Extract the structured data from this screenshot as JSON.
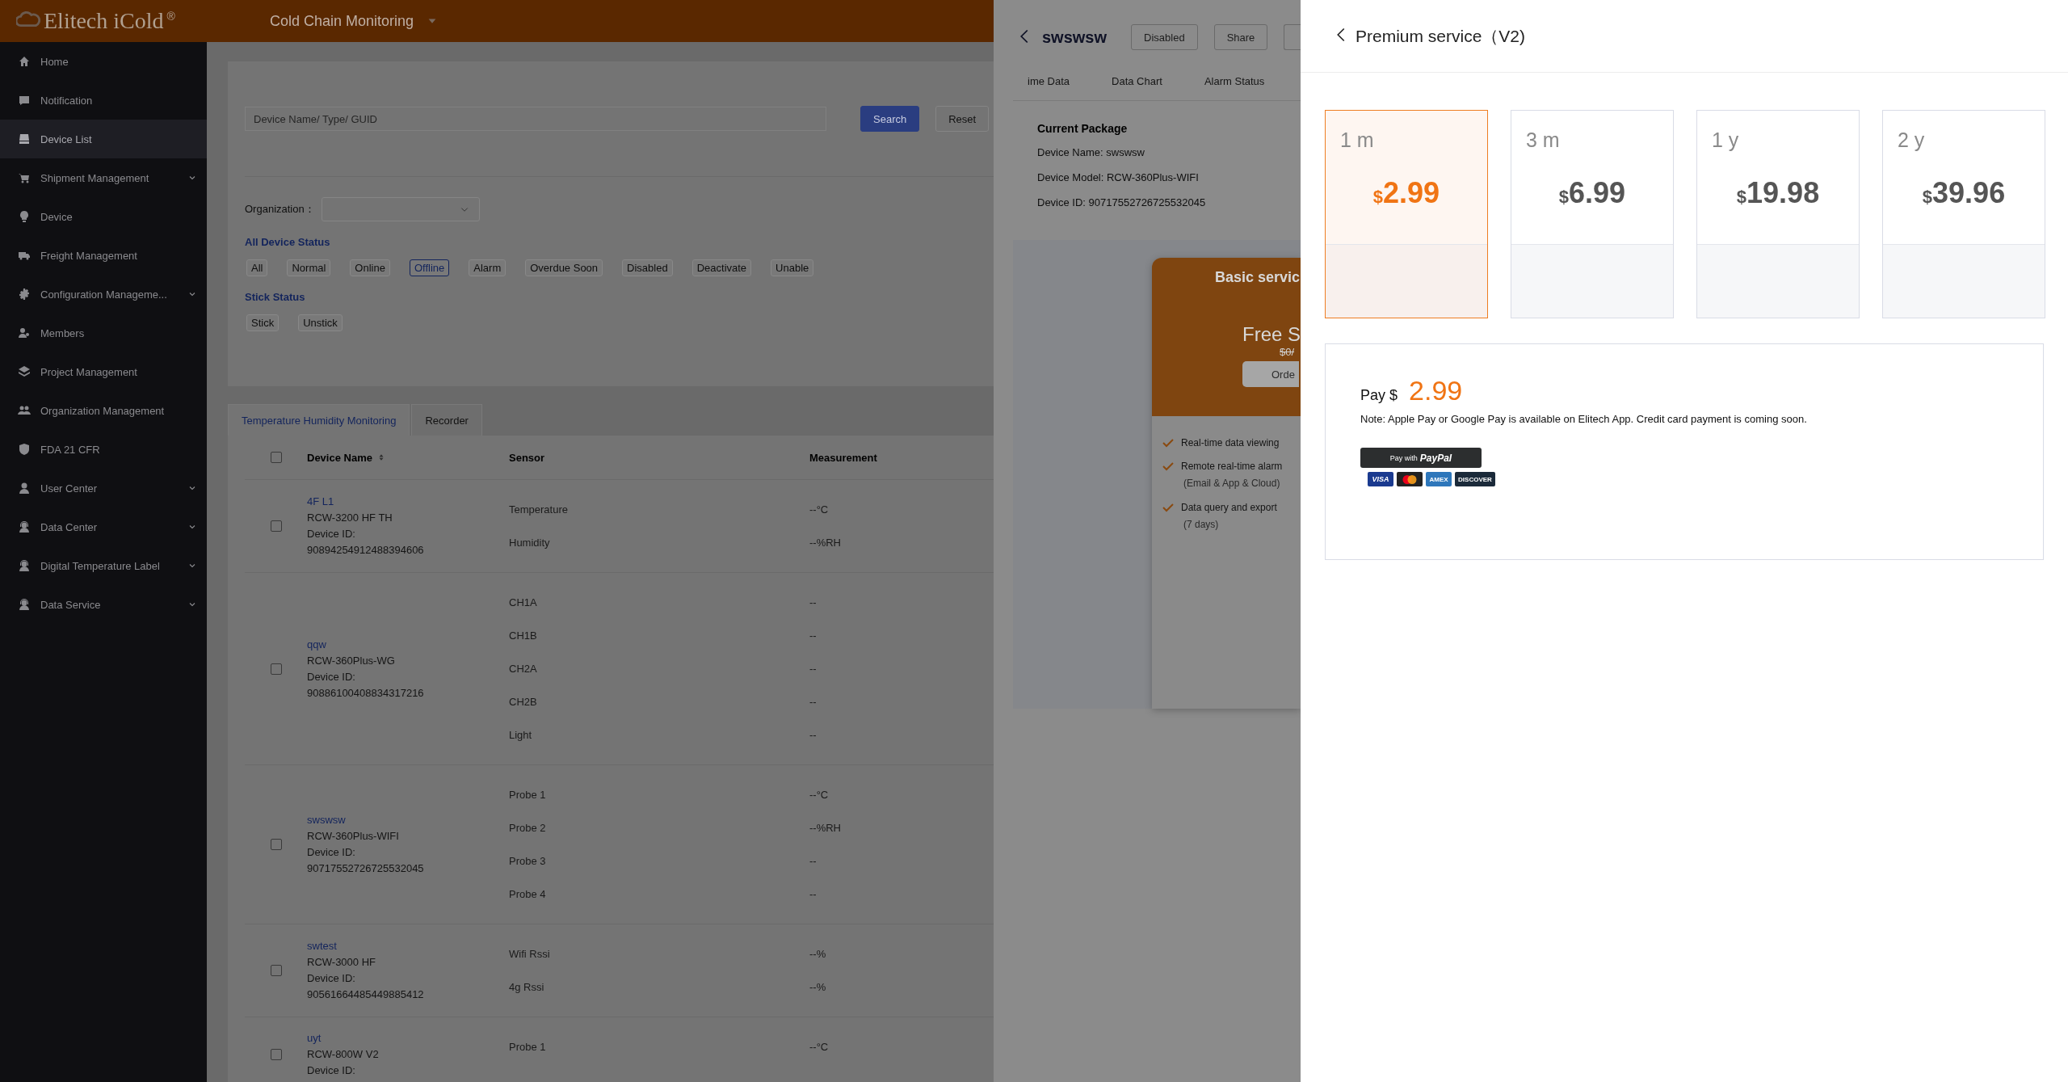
{
  "header": {
    "logo": "Elitech iCold",
    "logo_mark": "®",
    "app_title": "Cold Chain Monitoring"
  },
  "sidebar": {
    "items": [
      {
        "label": "Home",
        "selected": false,
        "expandable": false
      },
      {
        "label": "Notification",
        "selected": false,
        "expandable": false
      },
      {
        "label": "Device List",
        "selected": true,
        "expandable": false
      },
      {
        "label": "Shipment Management",
        "selected": false,
        "expandable": true
      },
      {
        "label": "Device",
        "selected": false,
        "expandable": false
      },
      {
        "label": "Freight Management",
        "selected": false,
        "expandable": false
      },
      {
        "label": "Configuration Manageme...",
        "selected": false,
        "expandable": true
      },
      {
        "label": "Members",
        "selected": false,
        "expandable": false
      },
      {
        "label": "Project Management",
        "selected": false,
        "expandable": false
      },
      {
        "label": "Organization Management",
        "selected": false,
        "expandable": false
      },
      {
        "label": "FDA 21 CFR",
        "selected": false,
        "expandable": false
      },
      {
        "label": "User Center",
        "selected": false,
        "expandable": true
      },
      {
        "label": "Data Center",
        "selected": false,
        "expandable": true
      },
      {
        "label": "Digital Temperature Label",
        "selected": false,
        "expandable": true
      },
      {
        "label": "Data Service",
        "selected": false,
        "expandable": true
      }
    ]
  },
  "filters": {
    "search": {
      "placeholder": "Device Name/ Type/ GUID"
    },
    "buttons": [
      {
        "label": "Search",
        "kind": "primary"
      },
      {
        "label": "Reset",
        "kind": "default"
      }
    ],
    "organization": {
      "label": "Organization："
    },
    "groups": [
      {
        "title": "All Device Status",
        "chips": [
          {
            "label": "All",
            "selected": false
          },
          {
            "label": "Normal",
            "selected": false
          },
          {
            "label": "Online",
            "selected": false
          },
          {
            "label": "Offline",
            "selected": true
          },
          {
            "label": "Alarm",
            "selected": false
          },
          {
            "label": "Overdue Soon",
            "selected": false
          },
          {
            "label": "Disabled",
            "selected": false
          },
          {
            "label": "Deactivate",
            "selected": false
          },
          {
            "label": "Unable",
            "selected": false
          }
        ]
      },
      {
        "title": "Stick Status",
        "chips": [
          {
            "label": "Stick",
            "selected": false
          },
          {
            "label": "Unstick",
            "selected": false
          }
        ]
      }
    ]
  },
  "tabs": [
    {
      "label": "Temperature Humidity Monitoring",
      "selected": true
    },
    {
      "label": "Recorder",
      "selected": false
    }
  ],
  "table": {
    "all_checked": false,
    "columns": [
      "Device Name",
      "Sensor",
      "Measurement"
    ],
    "rows": [
      {
        "checked": false,
        "name": "4F L1",
        "model": "RCW-3200 HF TH",
        "id_label": "Device ID:",
        "device_id": "90894254912488394606",
        "sensors": [
          {
            "name": "Temperature",
            "value": "--°C"
          },
          {
            "name": "Humidity",
            "value": "--%RH"
          }
        ]
      },
      {
        "checked": false,
        "name": "qqw",
        "model": "RCW-360Plus-WG",
        "id_label": "Device ID:",
        "device_id": "90886100408834317216",
        "sensors": [
          {
            "name": "CH1A",
            "value": "--"
          },
          {
            "name": "CH1B",
            "value": "--"
          },
          {
            "name": "CH2A",
            "value": "--"
          },
          {
            "name": "CH2B",
            "value": "--"
          },
          {
            "name": "Light",
            "value": "--"
          }
        ]
      },
      {
        "checked": false,
        "name": "swswsw",
        "model": "RCW-360Plus-WIFI",
        "id_label": "Device ID:",
        "device_id": "90717552726725532045",
        "sensors": [
          {
            "name": "Probe 1",
            "value": "--°C"
          },
          {
            "name": "Probe 2",
            "value": "--%RH"
          },
          {
            "name": "Probe 3",
            "value": "--"
          },
          {
            "name": "Probe 4",
            "value": "--"
          }
        ]
      },
      {
        "checked": false,
        "name": "swtest",
        "model": "RCW-3000 HF",
        "id_label": "Device ID:",
        "device_id": "90561664485449885412",
        "sensors": [
          {
            "name": "Wifi Rssi",
            "value": "--%"
          },
          {
            "name": "4g Rssi",
            "value": "--%"
          }
        ]
      },
      {
        "checked": false,
        "name": "uyt",
        "model": "RCW-800W V2",
        "id_label": "Device ID:",
        "sensors": [
          {
            "name": "Probe 1",
            "value": "--°C"
          }
        ]
      }
    ]
  },
  "device_drawer": {
    "title": "swswsw",
    "buttons": [
      "Disabled",
      "Share"
    ],
    "tabs": [
      "ime Data",
      "Data Chart",
      "Alarm Status"
    ],
    "current_package": {
      "title": "Current Package",
      "lines": [
        "Device Name: swswsw",
        "Device Model: RCW-360Plus-WIFI",
        "Device ID: 90717552726725532045"
      ]
    },
    "basic_card": {
      "title": "Basic servic",
      "price": "Free S",
      "old_price": "$0/",
      "button": "Orde",
      "features": [
        {
          "text": "Real-time data viewing"
        },
        {
          "text": "Remote real-time alarm",
          "note": "(Email & App & Cloud)"
        },
        {
          "text": "Data query and export",
          "note": "(7 days)"
        }
      ]
    }
  },
  "premium": {
    "title": "Premium service（V2)",
    "plans": [
      {
        "period": "1 m",
        "currency": "$",
        "price": "2.99",
        "selected": true
      },
      {
        "period": "3 m",
        "currency": "$",
        "price": "6.99",
        "selected": false
      },
      {
        "period": "1 y",
        "currency": "$",
        "price": "19.98",
        "selected": false
      },
      {
        "period": "2 y",
        "currency": "$",
        "price": "39.96",
        "selected": false
      }
    ],
    "pay": {
      "label": "Pay $",
      "amount": "2.99",
      "note": "Note: Apple Pay or Google Pay is available on Elitech App. Credit card payment is coming soon.",
      "paypal": {
        "prefix": "Pay with",
        "brand": "PayPal"
      },
      "cards": [
        {
          "kind": "visa",
          "label": "VISA"
        },
        {
          "kind": "mastercard"
        },
        {
          "kind": "amex",
          "label": "AMEX"
        },
        {
          "kind": "discover",
          "label": "DISCOVER"
        }
      ]
    }
  }
}
